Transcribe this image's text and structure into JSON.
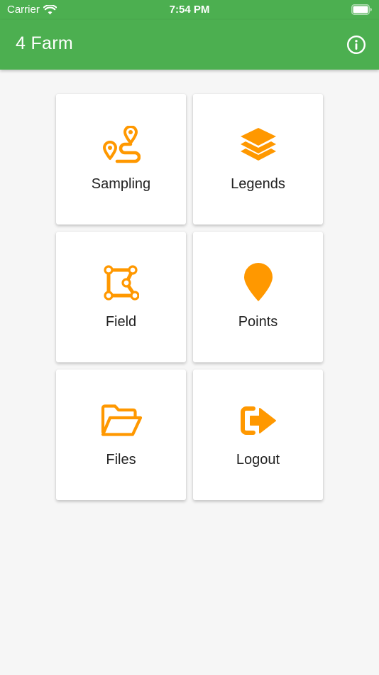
{
  "status_bar": {
    "carrier": "Carrier",
    "time": "7:54 PM"
  },
  "app_bar": {
    "title": "4 Farm",
    "info_icon": "info-circle-icon"
  },
  "colors": {
    "primary": "#4caf50",
    "accent": "#ff9800",
    "background": "#f6f6f6"
  },
  "menu": [
    {
      "label": "Sampling",
      "icon": "route-icon"
    },
    {
      "label": "Legends",
      "icon": "layers-icon"
    },
    {
      "label": "Field",
      "icon": "polygon-icon"
    },
    {
      "label": "Points",
      "icon": "map-pin-icon"
    },
    {
      "label": "Files",
      "icon": "folder-open-icon"
    },
    {
      "label": "Logout",
      "icon": "sign-out-icon"
    }
  ]
}
